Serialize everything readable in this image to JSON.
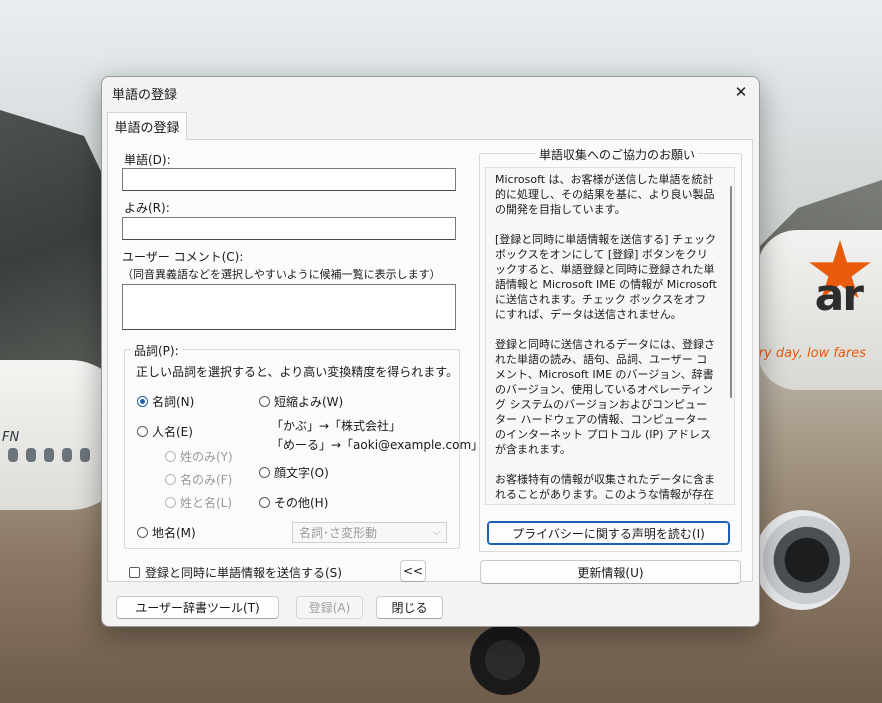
{
  "dialog": {
    "title": "単語の登録",
    "close_glyph": "✕",
    "tab_label": "単語の登録"
  },
  "form": {
    "word_label": "単語(D):",
    "word_value": "",
    "reading_label": "よみ(R):",
    "reading_value": "",
    "comment_label": "ユーザー コメント(C):",
    "comment_hint": "（同音異義語などを選択しやすいように候補一覧に表示します）",
    "comment_value": ""
  },
  "pos": {
    "group_label": "品詞(P):",
    "description": "正しい品詞を選択すると、より高い変換精度を得られます。",
    "options": {
      "noun": "名詞(N)",
      "person": "人名(E)",
      "surname": "姓のみ(Y)",
      "given_name": "名のみ(F)",
      "full_name": "姓と名(L)",
      "place": "地名(M)",
      "abbrev": "短縮よみ(W)",
      "abbrev_example1": "「かぶ」→「株式会社」",
      "abbrev_example2": "「めーる」→「aoki@example.com」",
      "emoticon": "顔文字(O)",
      "other": "その他(H)"
    },
    "selected": "noun",
    "subtype_select": "名詞･さ変形動"
  },
  "send_checkbox": {
    "label": "登録と同時に単語情報を送信する(S)",
    "checked": false
  },
  "collapse_button": "<<",
  "info": {
    "group_label": "単語収集へのご協力のお願い",
    "paragraphs": [
      "Microsoft は、お客様が送信した単語を統計的に処理し、その結果を基に、より良い製品の開発を目指しています。",
      "[登録と同時に単語情報を送信する] チェック ボックスをオンにして [登録] ボタンをクリックすると、単語登録と同時に登録された単語情報と Microsoft IME の情報が Microsoft に送信されます。チェック ボックスをオフにすれば、データは送信されません。",
      "登録と同時に送信されるデータには、登録された単語の読み、語句、品詞、ユーザー コメント、Microsoft IME のバージョン、辞書のバージョン、使用しているオペレーティング システムのバージョンおよびコンピューター ハードウェアの情報、コンピューターのインターネット プロトコル (IP) アドレスが含まれます。",
      "お客様特有の情報が収集されたデータに含まれることがあります。このような情報が存在する場合でも、Microsoft では、お客様を特定するために使用することはありません。"
    ],
    "privacy_button": "プライバシーに関する声明を読む(I)"
  },
  "buttons": {
    "update_info": "更新情報(U)",
    "user_dict_tool": "ユーザー辞書ツール(T)",
    "register": "登録(A)",
    "close": "閉じる"
  },
  "background": {
    "plane_text": "FN",
    "brand_text": "ar",
    "slogan": "ry day, low fares"
  }
}
